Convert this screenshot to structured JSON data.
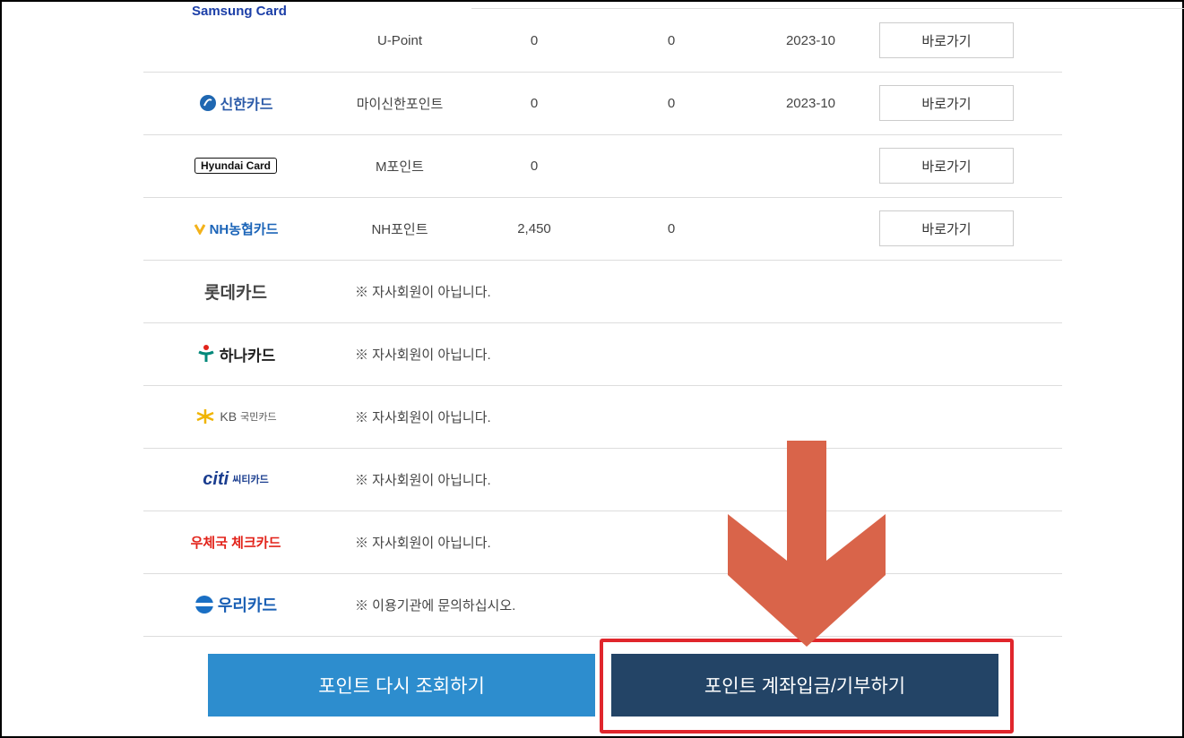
{
  "rows": [
    {
      "card": "Samsung Card",
      "point_name": "U-Point",
      "points": "0",
      "expiring": "0",
      "date": "2023-10",
      "action": "바로가기"
    },
    {
      "card": "신한카드",
      "point_name": "마이신한포인트",
      "points": "0",
      "expiring": "0",
      "date": "2023-10",
      "action": "바로가기"
    },
    {
      "card": "Hyundai Card",
      "point_name": "M포인트",
      "points": "0",
      "action": "바로가기"
    },
    {
      "card": "NH농협카드",
      "point_name": "NH포인트",
      "points": "2,450",
      "expiring": "0",
      "action": "바로가기"
    }
  ],
  "non_members": [
    {
      "card": "롯데카드",
      "notice": "※ 자사회원이 아닙니다."
    },
    {
      "card": "하나카드",
      "notice": "※ 자사회원이 아닙니다."
    },
    {
      "card_prefix": "KB",
      "card": "국민카드",
      "notice": "※ 자사회원이 아닙니다."
    },
    {
      "card_prefix": "citi",
      "card": "씨티카드",
      "notice": "※ 자사회원이 아닙니다."
    },
    {
      "card": "우체국 체크카드",
      "notice": "※ 자사회원이 아닙니다."
    },
    {
      "card": "우리카드",
      "notice": "※ 이용기관에 문의하십시오."
    }
  ],
  "buttons": {
    "requery": "포인트 다시 조회하기",
    "deposit": "포인트 계좌입금/기부하기"
  },
  "annotation": {
    "arrow_color": "#d9644a",
    "highlight_color": "#e0262c"
  }
}
